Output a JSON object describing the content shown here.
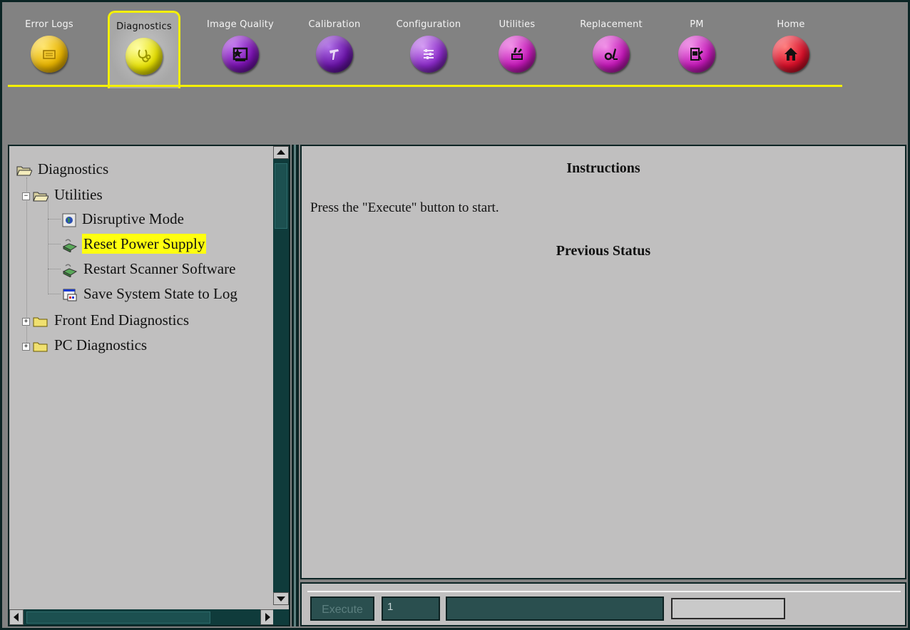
{
  "tabs": [
    {
      "label": "Error Logs",
      "icon": "error-logs-icon",
      "color": "#e8b400",
      "active": false
    },
    {
      "label": "Diagnostics",
      "icon": "stethoscope-icon",
      "color": "#e6e000",
      "active": true
    },
    {
      "label": "Image Quality",
      "icon": "image-quality-icon",
      "color": "#7a12b0",
      "active": false
    },
    {
      "label": "Calibration",
      "icon": "calibration-icon",
      "color": "#6a14a8",
      "active": false
    },
    {
      "label": "Configuration",
      "icon": "configuration-icon",
      "color": "#8a2ac8",
      "active": false
    },
    {
      "label": "Utilities",
      "icon": "utilities-icon",
      "color": "#c418b8",
      "active": false
    },
    {
      "label": "Replacement",
      "icon": "replacement-icon",
      "color": "#c418b8",
      "active": false
    },
    {
      "label": "PM",
      "icon": "pm-icon",
      "color": "#c418b8",
      "active": false
    },
    {
      "label": "Home",
      "icon": "home-icon",
      "color": "#d8102a",
      "active": false
    }
  ],
  "tree": {
    "root": "Diagnostics",
    "utilities": "Utilities",
    "items": [
      "Disruptive Mode",
      "Reset Power Supply",
      "Restart Scanner Software",
      "Save System State to Log"
    ],
    "selected": "Reset Power Supply",
    "front_end": "Front End Diagnostics",
    "pc": "PC Diagnostics"
  },
  "content": {
    "instructions_heading": "Instructions",
    "instructions_text": "Press the \"Execute\" button to start.",
    "previous_status_heading": "Previous Status"
  },
  "bottom": {
    "execute_label": "Execute",
    "field_value": "1",
    "progress": 0.0
  },
  "colors": {
    "highlight": "#ffff10",
    "tab_underline": "#f4f000",
    "panel": "#c0bfbf"
  }
}
